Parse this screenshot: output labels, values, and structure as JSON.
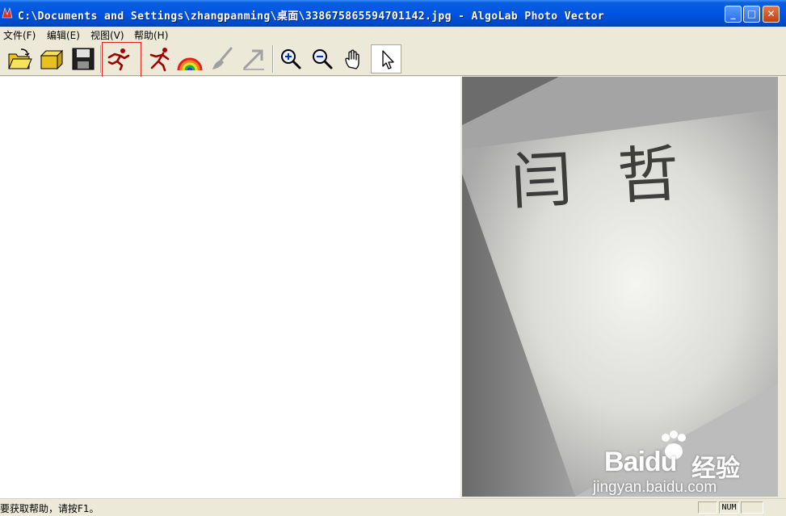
{
  "window": {
    "title": "C:\\Documents and Settings\\zhangpanming\\桌面\\338675865594701142.jpg - AlgoLab Photo Vector",
    "minimize_label": "_",
    "maximize_label": "□",
    "close_label": "✕"
  },
  "menu": {
    "items": [
      {
        "label": "文件(F)"
      },
      {
        "label": "编辑(E)"
      },
      {
        "label": "视图(V)"
      },
      {
        "label": "帮助(H)"
      }
    ]
  },
  "toolbar": {
    "buttons": [
      {
        "icon": "open-folder-icon"
      },
      {
        "icon": "open-image-icon"
      },
      {
        "icon": "save-disk-icon"
      },
      {
        "icon": "run-vectorize-icon",
        "highlighted": true
      },
      {
        "icon": "run-settings-icon"
      },
      {
        "icon": "rainbow-palette-icon"
      },
      {
        "icon": "brush-icon",
        "disabled": true
      },
      {
        "icon": "export-arrow-icon",
        "disabled": true
      },
      {
        "icon": "zoom-in-icon"
      },
      {
        "icon": "zoom-out-icon"
      },
      {
        "icon": "hand-pan-icon"
      },
      {
        "icon": "pointer-arrow-icon",
        "pressed": true
      }
    ]
  },
  "photo": {
    "handwriting": "闫哲"
  },
  "watermark": {
    "brand": "Baidu",
    "brand_cn": "经验",
    "url": "jingyan.baidu.com"
  },
  "status": {
    "help_text": "要获取帮助，请按F1。",
    "num_indicator": "NUM"
  },
  "colors": {
    "titlebar": "#0054e3",
    "highlight": "#e02020",
    "run_icon": "#a00000"
  }
}
